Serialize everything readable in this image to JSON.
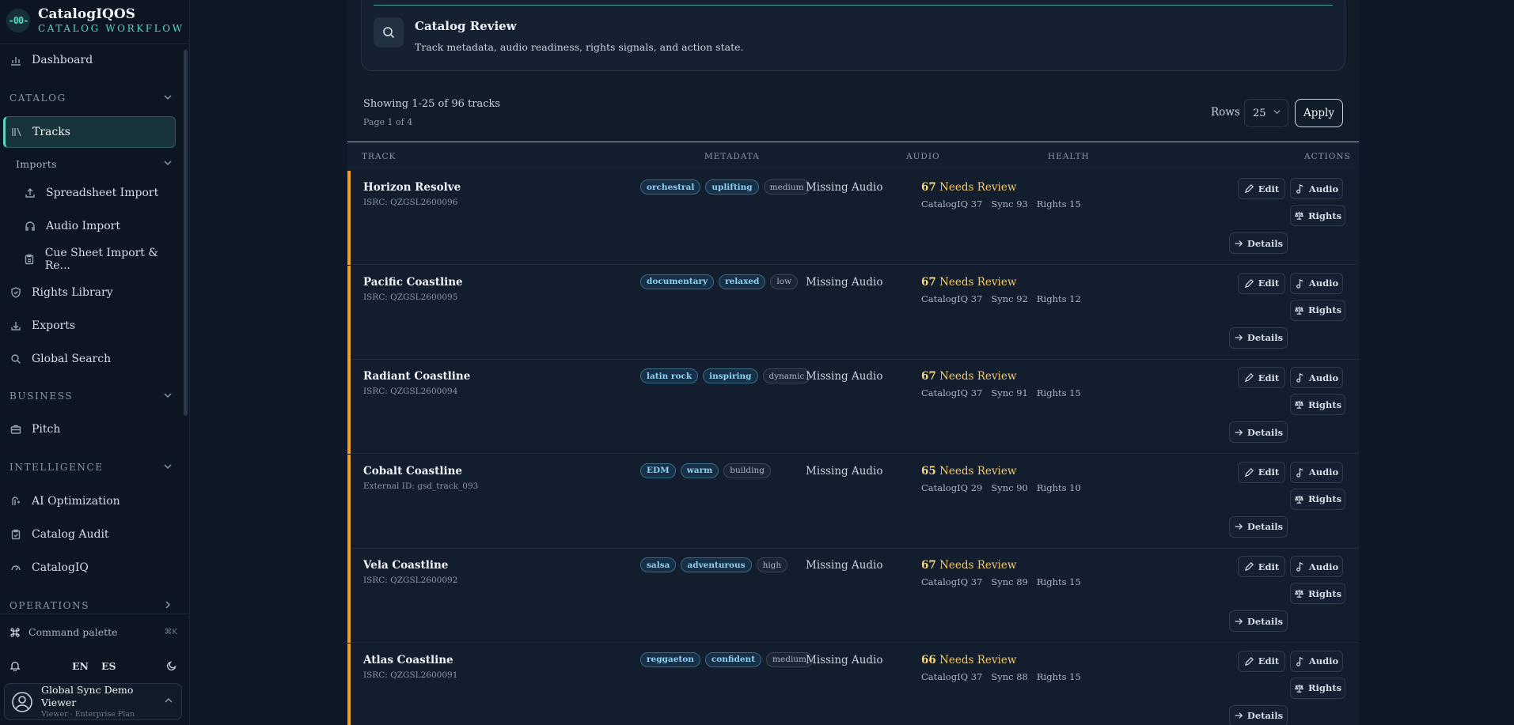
{
  "brand": {
    "logo_text": "-00-",
    "name": "CatalogIQOS",
    "subtitle": "CATALOG WORKFLOW"
  },
  "sidebar": {
    "dashboard": "Dashboard",
    "catalog_section": "CATALOG",
    "tracks": "Tracks",
    "imports_section": "Imports",
    "spreadsheet_import": "Spreadsheet Import",
    "audio_import": "Audio Import",
    "cue_sheet_import": "Cue Sheet Import & Re...",
    "rights_library": "Rights Library",
    "exports": "Exports",
    "global_search": "Global Search",
    "business_section": "BUSINESS",
    "pitch": "Pitch",
    "intelligence_section": "INTELLIGENCE",
    "ai_optimization": "AI Optimization",
    "catalog_audit": "Catalog Audit",
    "catalogiq": "CatalogIQ",
    "operations_section": "OPERATIONS",
    "command_palette": "Command palette",
    "command_shortcut": "⌘K",
    "lang_en": "EN",
    "lang_es": "ES",
    "user_name": "Global Sync Demo Viewer",
    "user_role": "Viewer · Enterprise Plan"
  },
  "review": {
    "title": "Catalog Review",
    "description": "Track metadata, audio readiness, rights signals, and action state."
  },
  "pagination": {
    "showing": "Showing 1-25 of 96 tracks",
    "page": "Page 1 of 4",
    "rows_label": "Rows",
    "rows_value": "25",
    "apply": "Apply"
  },
  "table": {
    "headers": {
      "track": "TRACK",
      "metadata": "METADATA",
      "audio": "AUDIO",
      "health": "HEALTH",
      "actions": "ACTIONS"
    },
    "actions": {
      "edit": "Edit",
      "audio": "Audio",
      "rights": "Rights",
      "details": "Details"
    },
    "rows": [
      {
        "title": "Horizon Resolve",
        "id": "ISRC: QZGSL2600096",
        "tags": [
          "orchestral",
          "uplifting",
          "medium"
        ],
        "audio": "Missing Audio",
        "score": "67",
        "status": "Needs Review",
        "catalogiq": "CatalogIQ 37",
        "sync": "Sync 93",
        "rights": "Rights 15"
      },
      {
        "title": "Pacific Coastline",
        "id": "ISRC: QZGSL2600095",
        "tags": [
          "documentary",
          "relaxed",
          "low"
        ],
        "audio": "Missing Audio",
        "score": "67",
        "status": "Needs Review",
        "catalogiq": "CatalogIQ 37",
        "sync": "Sync 92",
        "rights": "Rights 12"
      },
      {
        "title": "Radiant Coastline",
        "id": "ISRC: QZGSL2600094",
        "tags": [
          "latin rock",
          "inspiring",
          "dynamic"
        ],
        "audio": "Missing Audio",
        "score": "67",
        "status": "Needs Review",
        "catalogiq": "CatalogIQ 37",
        "sync": "Sync 91",
        "rights": "Rights 15"
      },
      {
        "title": "Cobalt Coastline",
        "id": "External ID: gsd_track_093",
        "tags": [
          "EDM",
          "warm",
          "building"
        ],
        "audio": "Missing Audio",
        "score": "65",
        "status": "Needs Review",
        "catalogiq": "CatalogIQ 29",
        "sync": "Sync 90",
        "rights": "Rights 10"
      },
      {
        "title": "Vela Coastline",
        "id": "ISRC: QZGSL2600092",
        "tags": [
          "salsa",
          "adventurous",
          "high"
        ],
        "audio": "Missing Audio",
        "score": "67",
        "status": "Needs Review",
        "catalogiq": "CatalogIQ 37",
        "sync": "Sync 89",
        "rights": "Rights 15"
      },
      {
        "title": "Atlas Coastline",
        "id": "ISRC: QZGSL2600091",
        "tags": [
          "reggaeton",
          "confident",
          "medium"
        ],
        "audio": "Missing Audio",
        "score": "66",
        "status": "Needs Review",
        "catalogiq": "CatalogIQ 37",
        "sync": "Sync 88",
        "rights": "Rights 15"
      }
    ]
  }
}
